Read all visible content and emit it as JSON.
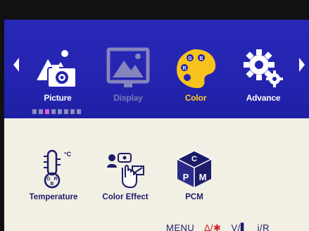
{
  "osd": {
    "tabs": [
      {
        "label": "Picture",
        "icon": "picture-icon",
        "state": "normal"
      },
      {
        "label": "Display",
        "icon": "display-icon",
        "state": "inactive"
      },
      {
        "label": "Color",
        "icon": "color-palette-icon",
        "state": "selected"
      },
      {
        "label": "Advance",
        "icon": "gears-icon",
        "state": "normal"
      }
    ],
    "page_indicator": {
      "count": 8,
      "current": 3
    },
    "submenu": [
      {
        "label": "Temperature",
        "icon": "thermometer-icon"
      },
      {
        "label": "Color Effect",
        "icon": "color-effect-icon"
      },
      {
        "label": "PCM",
        "icon": "pcm-cube-icon"
      }
    ],
    "hints": {
      "menu": "MENU",
      "up": "∆/✱",
      "down": "V/▌",
      "exit": "i/R"
    },
    "colors": {
      "band": "#2424b0",
      "selected_label": "#ffd21f",
      "palette_yellow": "#f7c21b",
      "submenu_text": "#1c1c6a"
    }
  }
}
